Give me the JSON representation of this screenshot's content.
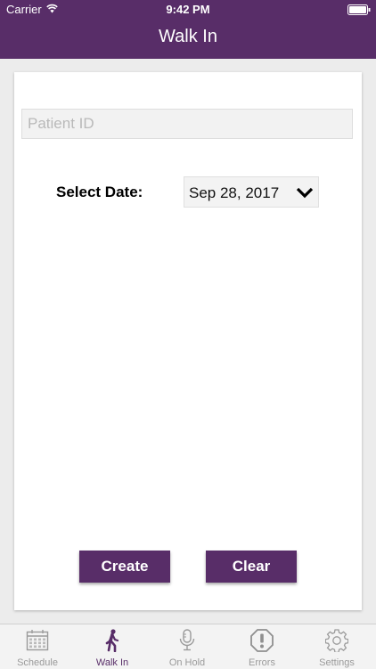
{
  "status_bar": {
    "carrier": "Carrier",
    "time": "9:42 PM"
  },
  "header": {
    "title": "Walk In"
  },
  "form": {
    "patient_id_placeholder": "Patient ID",
    "patient_id_value": "",
    "date_label": "Select Date:",
    "date_value": "Sep 28, 2017"
  },
  "buttons": {
    "create_label": "Create",
    "clear_label": "Clear"
  },
  "tabs": [
    {
      "label": "Schedule",
      "icon": "calendar-icon",
      "active": false
    },
    {
      "label": "Walk In",
      "icon": "walking-person-icon",
      "active": true
    },
    {
      "label": "On Hold",
      "icon": "microphone-icon",
      "active": false
    },
    {
      "label": "Errors",
      "icon": "exclamation-icon",
      "active": false
    },
    {
      "label": "Settings",
      "icon": "gear-icon",
      "active": false
    }
  ],
  "colors": {
    "brand": "#582d68",
    "tab_inactive": "#9a9a9a"
  }
}
